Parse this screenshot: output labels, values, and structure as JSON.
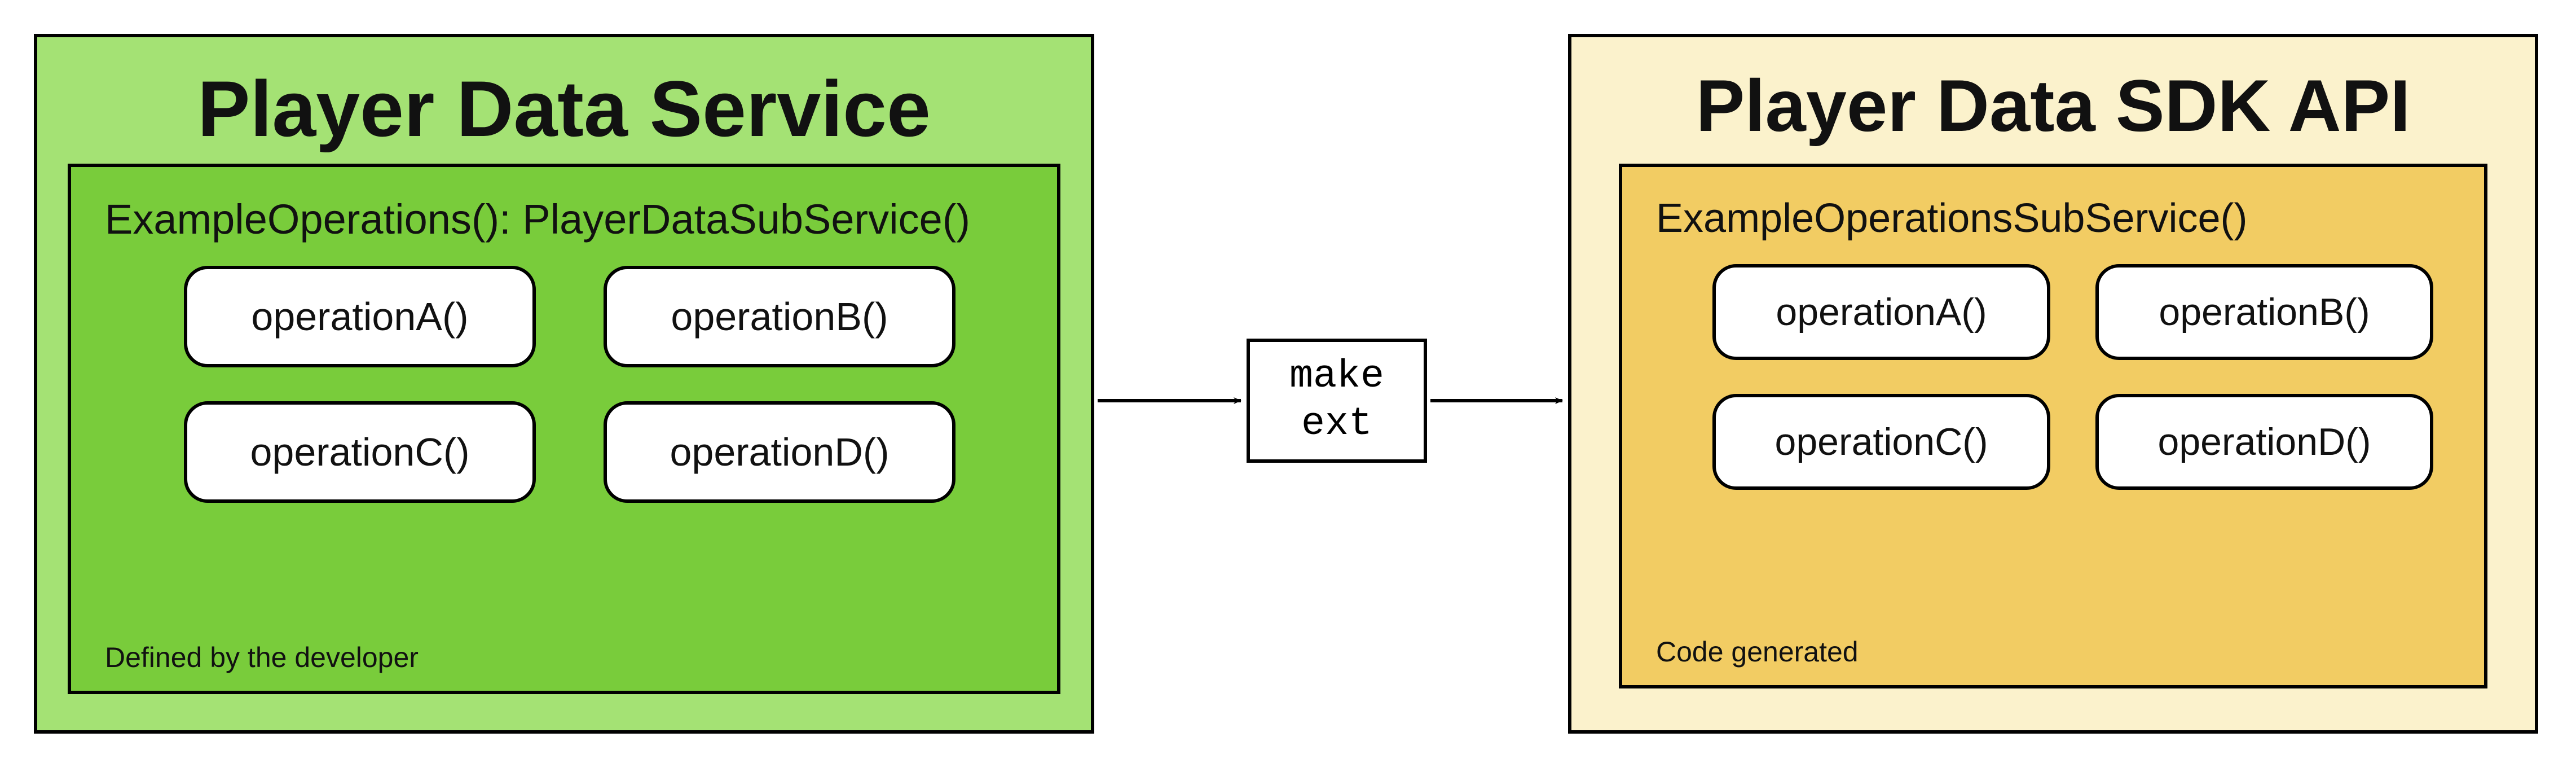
{
  "left": {
    "title": "Player Data Service",
    "subservice_label": "ExampleOperations(): PlayerDataSubService()",
    "operations": [
      "operationA()",
      "operationB()",
      "operationC()",
      "operationD()"
    ],
    "footnote": "Defined by the developer"
  },
  "center": {
    "command": "make\next"
  },
  "right": {
    "title": "Player Data SDK API",
    "subservice_label": "ExampleOperationsSubService()",
    "operations": [
      "operationA()",
      "operationB()",
      "operationC()",
      "operationD()"
    ],
    "footnote": "Code generated"
  },
  "colors": {
    "left_outer_bg": "#a4e274",
    "left_inner_bg": "#79cc3b",
    "right_outer_bg": "#fbf2cc",
    "right_inner_bg": "#f2cc63",
    "border": "#000000",
    "pill_bg": "#ffffff"
  }
}
